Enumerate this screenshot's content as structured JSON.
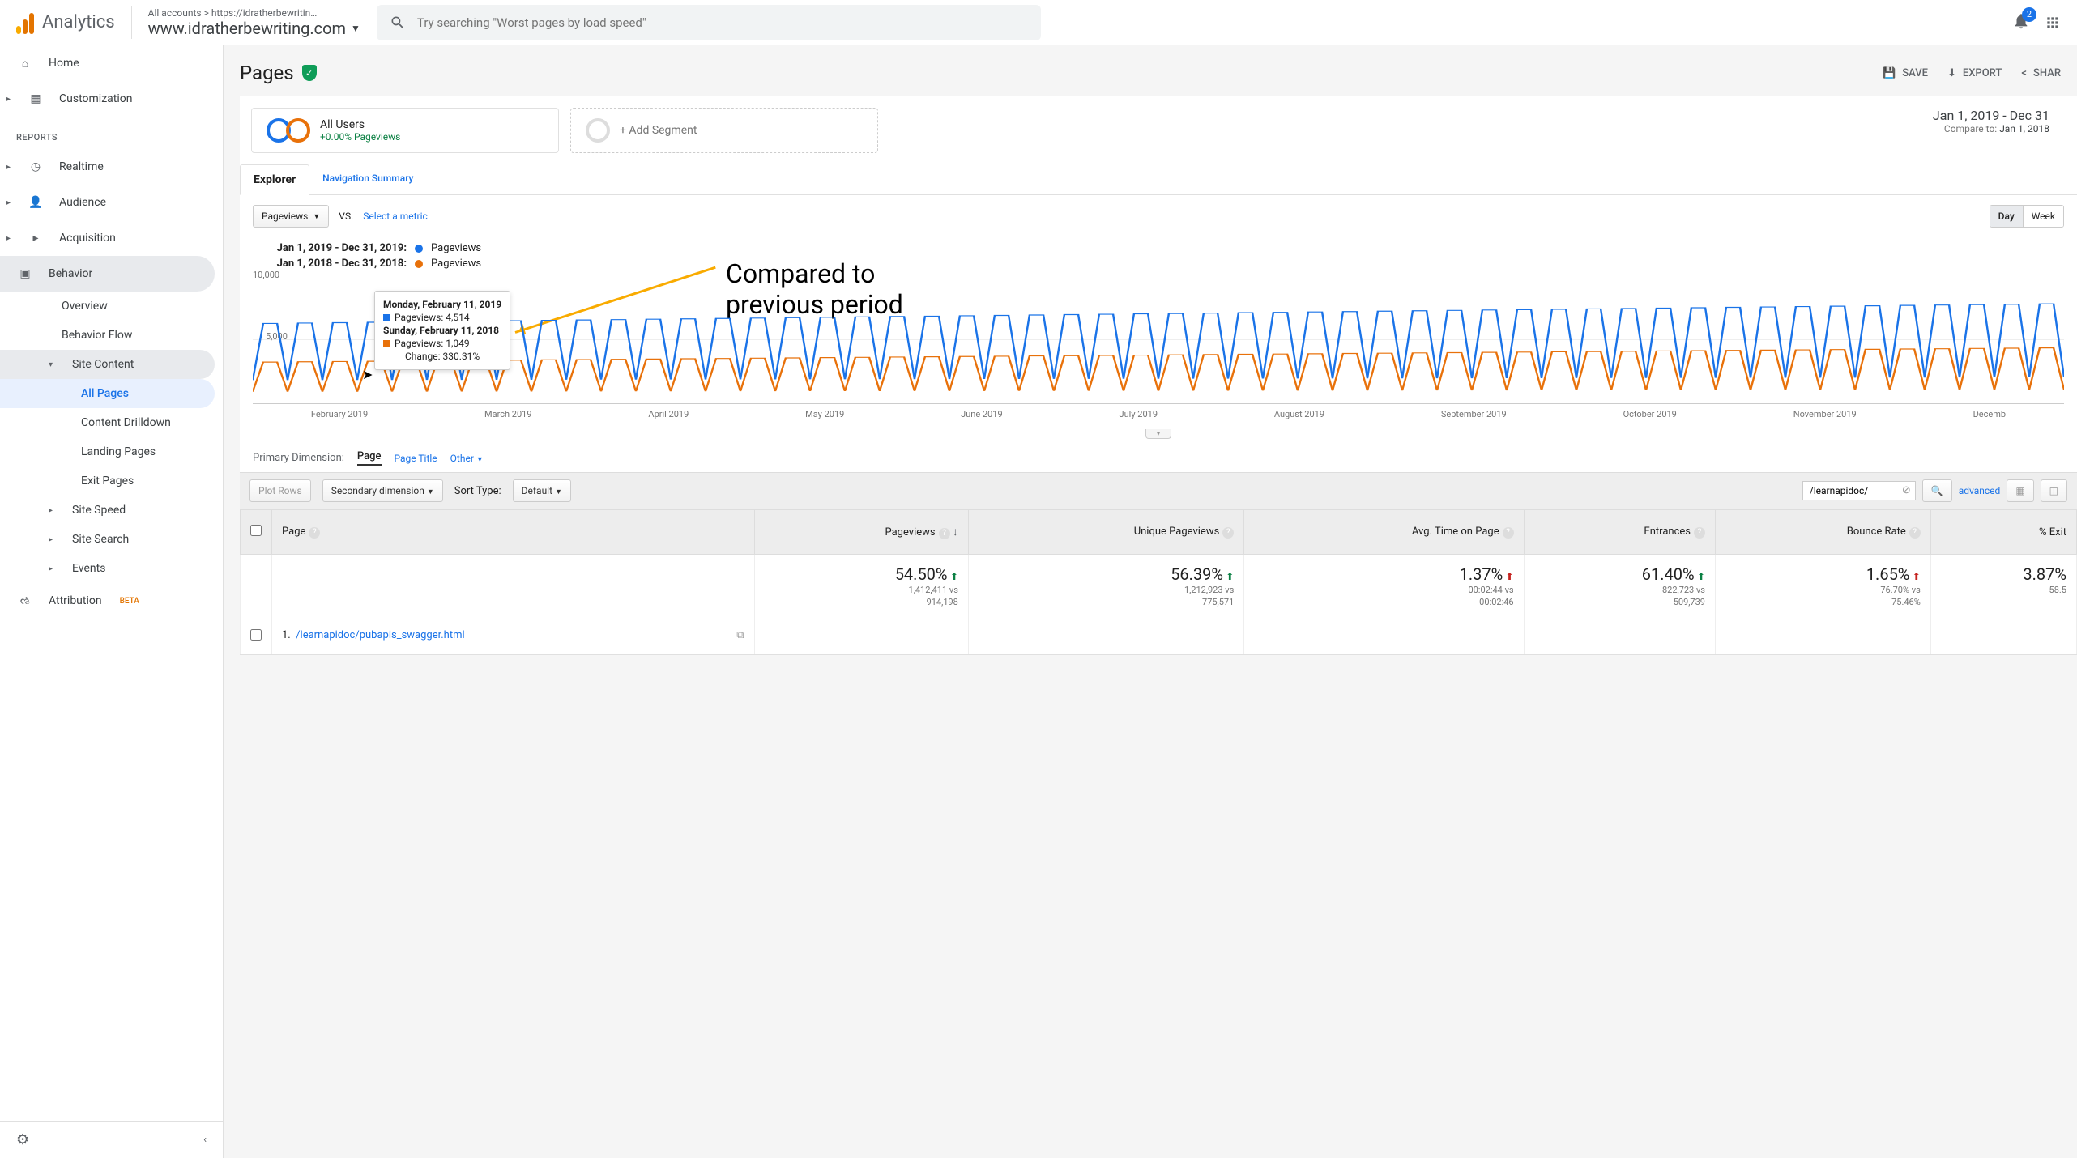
{
  "header": {
    "logo_text": "Analytics",
    "property_path": "All accounts > https://idratherbewritin…",
    "property_name": "www.idratherbewriting.com",
    "search_placeholder": "Try searching \"Worst pages by load speed\"",
    "notif_count": "2"
  },
  "sidebar": {
    "home": "Home",
    "customization": "Customization",
    "reports_heading": "REPORTS",
    "realtime": "Realtime",
    "audience": "Audience",
    "acquisition": "Acquisition",
    "behavior": "Behavior",
    "overview": "Overview",
    "behavior_flow": "Behavior Flow",
    "site_content": "Site Content",
    "all_pages": "All Pages",
    "content_drilldown": "Content Drilldown",
    "landing_pages": "Landing Pages",
    "exit_pages": "Exit Pages",
    "site_speed": "Site Speed",
    "site_search": "Site Search",
    "events": "Events",
    "attribution": "Attribution",
    "beta": "BETA"
  },
  "page": {
    "title": "Pages",
    "save": "SAVE",
    "export": "EXPORT",
    "share": "SHAR"
  },
  "segments": {
    "all_users": "All Users",
    "all_users_sub": "+0.00% Pageviews",
    "add_segment": "+ Add Segment"
  },
  "date_range": {
    "main": "Jan 1, 2019 - Dec 31",
    "compare_label": "Compare to:",
    "compare": "Jan 1, 2018"
  },
  "tabs": {
    "explorer": "Explorer",
    "navsum": "Navigation Summary"
  },
  "metric": {
    "selected": "Pageviews",
    "vs": "VS.",
    "select": "Select a metric",
    "day": "Day",
    "week": "Week"
  },
  "legend": {
    "range1": "Jan 1, 2019 - Dec 31, 2019:",
    "range2": "Jan 1, 2018 - Dec 31, 2018:",
    "metric": "Pageviews"
  },
  "chart_data": {
    "type": "line",
    "ylabel_top": "10,000",
    "ylabel_mid": "5,000",
    "ylim": [
      0,
      10000
    ],
    "x_labels": [
      "February 2019",
      "March 2019",
      "April 2019",
      "May 2019",
      "June 2019",
      "July 2019",
      "August 2019",
      "September 2019",
      "October 2019",
      "November 2019",
      "Decemb"
    ],
    "series": [
      {
        "name": "2019",
        "color": "#1a73e8",
        "approx_min": 1800,
        "approx_max": 7800
      },
      {
        "name": "2018",
        "color": "#e8710a",
        "approx_min": 900,
        "approx_max": 4500
      }
    ],
    "tooltip": {
      "date1": "Monday, February 11, 2019",
      "label1": "Pageviews: 4,514",
      "date2": "Sunday, February 11, 2018",
      "label2": "Pageviews: 1,049",
      "change": "Change: 330.31%"
    }
  },
  "annotation": {
    "line1": "Compared to",
    "line2": "previous period"
  },
  "dimensions": {
    "label": "Primary Dimension:",
    "page": "Page",
    "page_title": "Page Title",
    "other": "Other"
  },
  "toolbar": {
    "plot_rows": "Plot Rows",
    "secondary_dim": "Secondary dimension",
    "sort_type": "Sort Type:",
    "default": "Default",
    "filter_value": "/learnapidoc/",
    "advanced": "advanced"
  },
  "table": {
    "headers": {
      "page": "Page",
      "pageviews": "Pageviews",
      "unique": "Unique Pageviews",
      "avg_time": "Avg. Time on Page",
      "entrances": "Entrances",
      "bounce": "Bounce Rate",
      "exit": "% Exit"
    },
    "totals": {
      "pageviews": {
        "pct": "54.50%",
        "dir": "up",
        "l1": "1,412,411 vs",
        "l2": "914,198"
      },
      "unique": {
        "pct": "56.39%",
        "dir": "up",
        "l1": "1,212,923 vs",
        "l2": "775,571"
      },
      "avg_time": {
        "pct": "1.37%",
        "dir": "down",
        "l1": "00:02:44 vs",
        "l2": "00:02:46"
      },
      "entrances": {
        "pct": "61.40%",
        "dir": "up",
        "l1": "822,723 vs",
        "l2": "509,739"
      },
      "bounce": {
        "pct": "1.65%",
        "dir": "up",
        "l1": "76.70% vs",
        "l2": "75.46%"
      },
      "exit": {
        "pct": "3.87%",
        "l1": "58.5"
      }
    },
    "rows": [
      {
        "idx": "1.",
        "path": "/learnapidoc/pubapis_swagger.html"
      }
    ]
  }
}
